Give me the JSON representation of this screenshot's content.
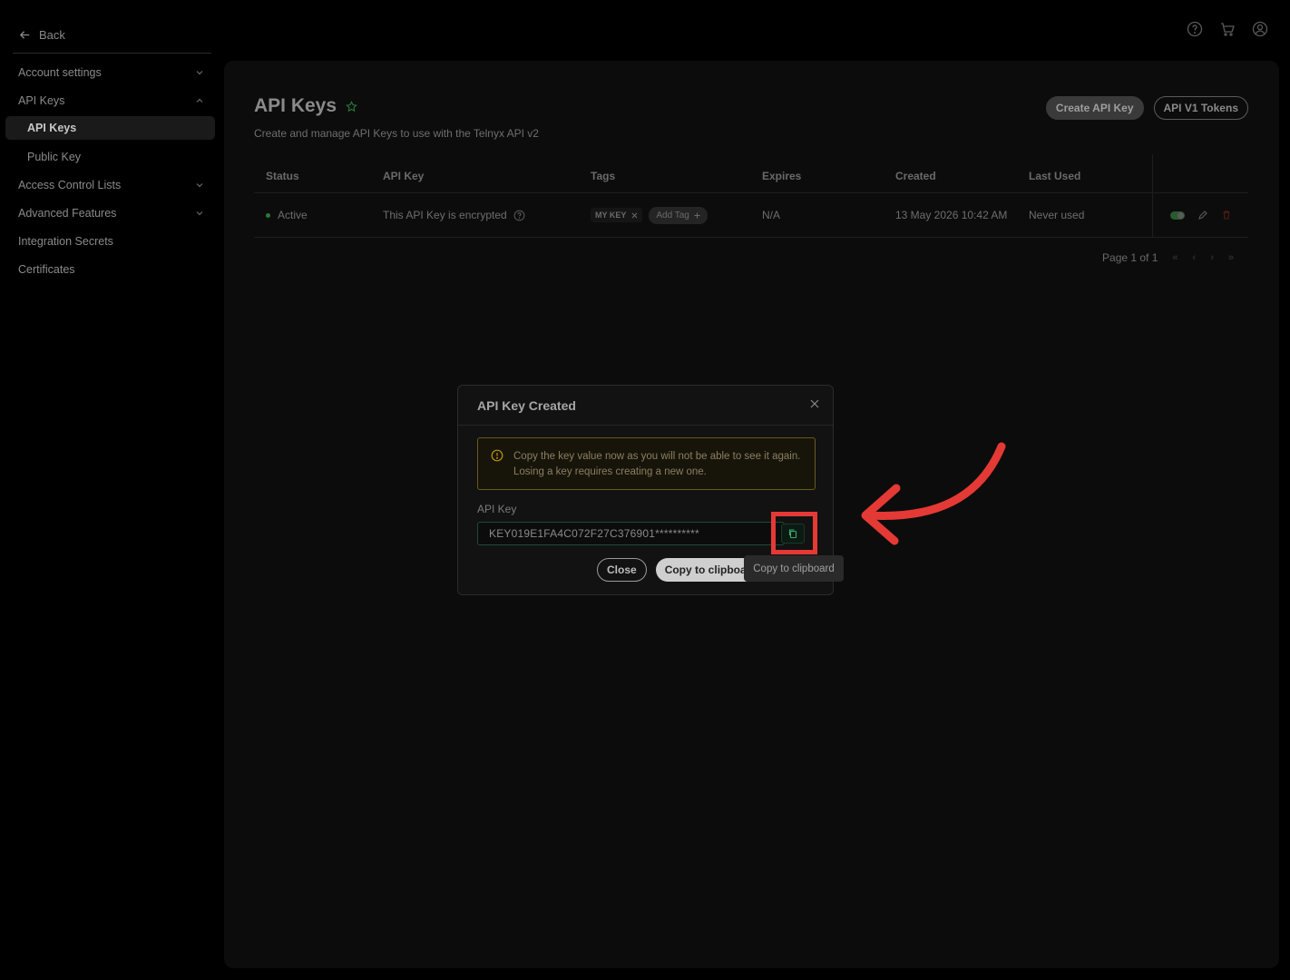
{
  "sidebar": {
    "back_label": "Back",
    "items": [
      {
        "label": "Account settings"
      },
      {
        "label": "API Keys"
      },
      {
        "label": "API Keys"
      },
      {
        "label": "Public Key"
      },
      {
        "label": "Access Control Lists"
      },
      {
        "label": "Advanced Features"
      },
      {
        "label": "Integration Secrets"
      },
      {
        "label": "Certificates"
      }
    ]
  },
  "top_icons": [
    "help-icon",
    "cart-icon",
    "user-icon"
  ],
  "page": {
    "title": "API Keys",
    "subtitle": "Create and manage API Keys to use with the Telnyx API v2",
    "create_button": "Create API Key",
    "v1_button": "API V1 Tokens"
  },
  "table": {
    "headers": [
      "Status",
      "API Key",
      "Tags",
      "Expires",
      "Created",
      "Last Used"
    ],
    "rows": [
      {
        "status": "Active",
        "api_key": "This API Key is encrypted",
        "tag": "MY KEY",
        "add_tag": "Add Tag",
        "expires": "N/A",
        "created": "13 May 2026 10:42 AM",
        "last_used": "Never used"
      }
    ],
    "pagination": "Page 1 of 1"
  },
  "modal": {
    "title": "API Key Created",
    "warning": "Copy the key value now as you will not be able to see it again. Losing a key requires creating a new one.",
    "key_label": "API Key",
    "key_value": "KEY019E1FA4C072F27C376901**********",
    "close_button": "Close",
    "copy_button": "Copy to clipboard",
    "tooltip": "Copy to clipboard"
  },
  "colors": {
    "accent_green": "#2a7a3a",
    "warning_border": "#6a5a1a",
    "annotation_red": "#e53935"
  }
}
